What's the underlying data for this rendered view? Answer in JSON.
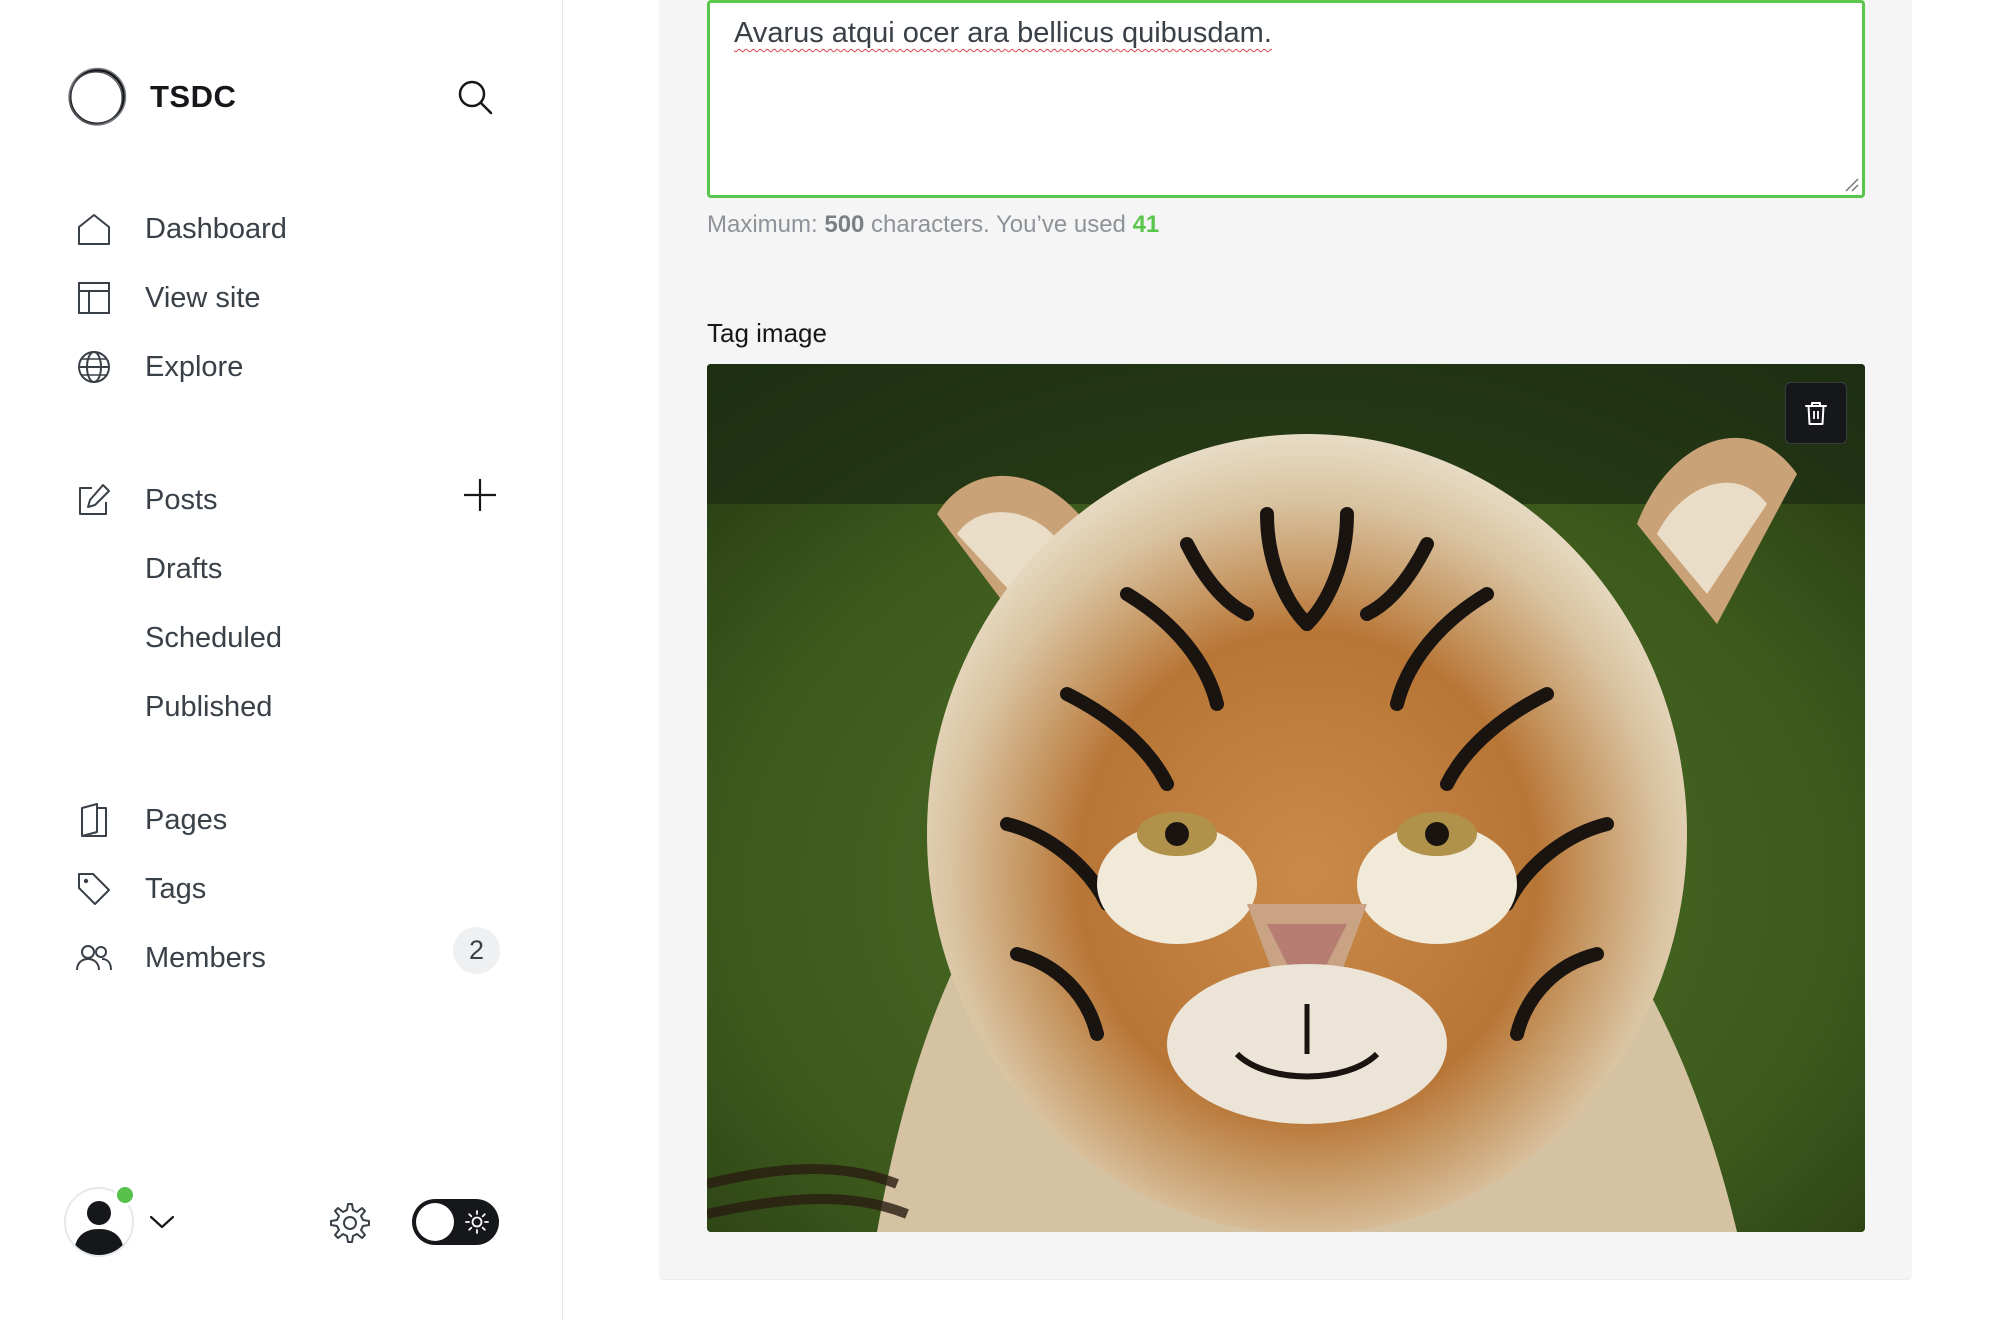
{
  "sidebar": {
    "brand_name": "TSDC",
    "nav": {
      "dashboard": "Dashboard",
      "view_site": "View site",
      "explore": "Explore",
      "posts": "Posts",
      "drafts": "Drafts",
      "scheduled": "Scheduled",
      "published": "Published",
      "pages": "Pages",
      "tags": "Tags",
      "members": "Members"
    },
    "members_count": "2",
    "icons": {
      "search": "search-icon",
      "dashboard": "home-icon",
      "view_site": "layout-icon",
      "explore": "globe-icon",
      "posts": "edit-icon",
      "new_post": "plus-icon",
      "pages": "page-icon",
      "tags": "tag-icon",
      "members": "users-icon",
      "settings": "gear-icon",
      "theme": "sun-icon"
    },
    "status_color": "#57c24b"
  },
  "editor": {
    "description_value": "Avarus atqui ocer ara bellicus quibusdam.",
    "hint_prefix": "Maximum: ",
    "hint_max": "500",
    "hint_middle": " characters. You’ve used ",
    "hint_used": "41",
    "tag_image_label": "Tag image",
    "accent_color": "#5ac64c"
  }
}
